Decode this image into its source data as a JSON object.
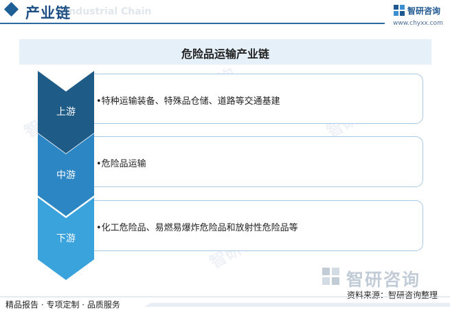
{
  "header": {
    "title": "产业链",
    "subtitle": "Industrial Chain",
    "brand_name": "智研咨询",
    "brand_url": "www.chyxx.com"
  },
  "banner": {
    "title": "危险品运输产业链"
  },
  "stages": [
    {
      "label": "上游",
      "content": "•特种运输装备、特殊品仓储、道路等交通基建",
      "color": "#1f5b87"
    },
    {
      "label": "中游",
      "content": "•危险品运输",
      "color": "#2c86c3"
    },
    {
      "label": "下游",
      "content": "•化工危险品、易燃易爆炸危险品和放射性危险品等",
      "color": "#3aa3dc"
    }
  ],
  "watermark": {
    "text": "智研咨询"
  },
  "source": "资料来源：智研咨询整理",
  "footer": {
    "tagline": "精品报告 · 专项定制 · 品质服务"
  },
  "colors": {
    "accent": "#1e5f96",
    "card_border": "#a8c7e3",
    "banner_bg": "#e6f0f9"
  }
}
